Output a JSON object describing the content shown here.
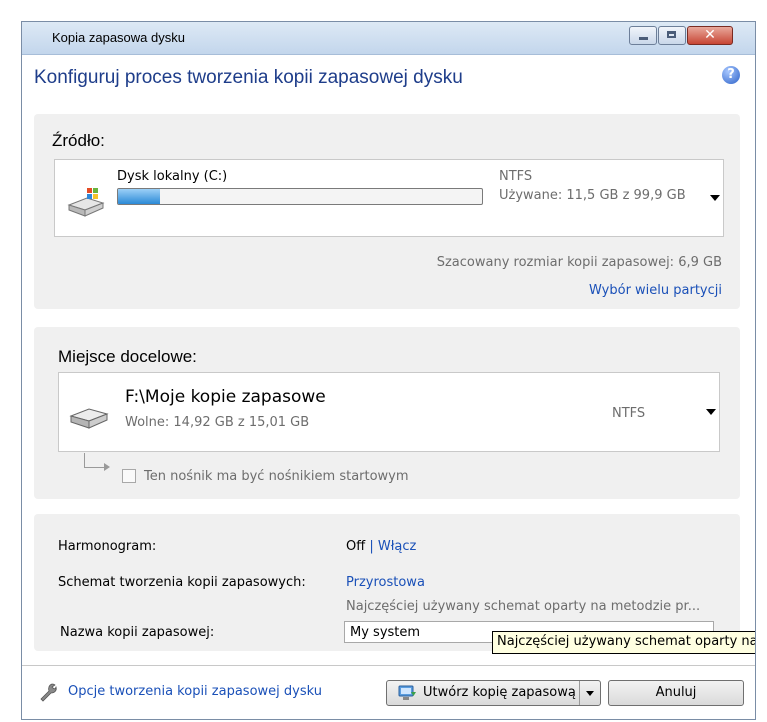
{
  "window": {
    "title": "Kopia zapasowa dysku"
  },
  "heading": "Konfiguruj proces tworzenia kopii zapasowej dysku",
  "source": {
    "label": "Źródło:",
    "disk_name": "Dysk lokalny (C:)",
    "filesystem": "NTFS",
    "used": "Używane: 11,5 GB z 99,9 GB",
    "used_fraction": 0.115,
    "estimated_size": "Szacowany rozmiar kopii zapasowej: 6,9 GB",
    "multi_partition_link": "Wybór wielu partycji"
  },
  "destination": {
    "label": "Miejsce docelowe:",
    "path": "F:\\Moje kopie zapasowe",
    "free": "Wolne: 14,92 GB z 15,01 GB",
    "filesystem": "NTFS",
    "bootable_label": "Ten nośnik ma być nośnikiem startowym",
    "bootable_checked": false
  },
  "options": {
    "schedule_label": "Harmonogram:",
    "schedule_off": "Off",
    "schedule_separator": "|",
    "schedule_enable": "Włącz",
    "scheme_label": "Schemat tworzenia kopii zapasowych:",
    "scheme_value": "Przyrostowa",
    "scheme_desc": "Najczęściej używany schemat oparty na metodzie pr...",
    "name_label": "Nazwa kopii zapasowej:",
    "name_value": "My system"
  },
  "tooltip": "Najczęściej używany schemat oparty na",
  "footer": {
    "options_link": "Opcje tworzenia kopii zapasowej dysku",
    "create_button": "Utwórz kopię zapasową",
    "cancel_button": "Anuluj"
  },
  "colors": {
    "link": "#1a50b8",
    "heading": "#1e3d8a",
    "panel": "#f0f0f0"
  },
  "icons": [
    "minimize-icon",
    "maximize-icon",
    "close-icon",
    "help-icon",
    "windows-drive-icon",
    "drive-icon",
    "wrench-icon",
    "backup-icon",
    "chevron-down-icon"
  ]
}
